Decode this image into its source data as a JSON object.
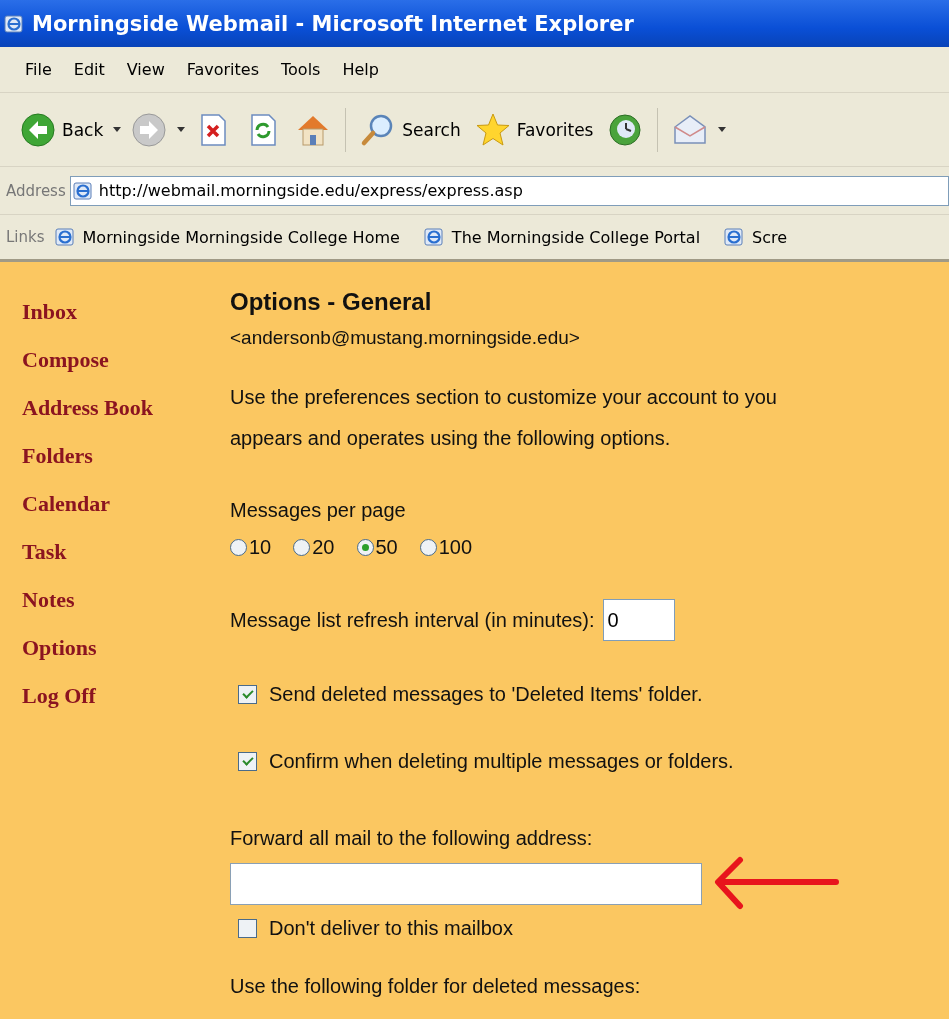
{
  "window": {
    "title": "Morningside Webmail - Microsoft Internet Explorer"
  },
  "menu": [
    "File",
    "Edit",
    "View",
    "Favorites",
    "Tools",
    "Help"
  ],
  "toolbar": [
    {
      "kind": "back",
      "label": "Back"
    },
    {
      "kind": "forward"
    },
    {
      "kind": "stop"
    },
    {
      "kind": "refresh"
    },
    {
      "kind": "home"
    },
    {
      "kind": "search",
      "label": "Search"
    },
    {
      "kind": "favorites",
      "label": "Favorites"
    },
    {
      "kind": "media"
    },
    {
      "kind": "mail"
    }
  ],
  "address": {
    "label": "Address",
    "url": "http://webmail.morningside.edu/express/express.asp"
  },
  "links": {
    "label": "Links",
    "items": [
      "Morningside Morningside College Home",
      "The Morningside College Portal",
      "Scre"
    ]
  },
  "sidebar": {
    "items": [
      "Inbox",
      "Compose",
      "Address Book",
      "Folders",
      "Calendar",
      "Task",
      "Notes",
      "Options",
      "Log Off"
    ]
  },
  "options": {
    "heading": "Options - General",
    "account": "<andersonb@mustang.morningside.edu>",
    "intro_lines": [
      "Use the preferences section to customize your account to you",
      "appears and operates using the following options."
    ],
    "messages_per_page": {
      "label": "Messages per page",
      "options": [
        {
          "label": "10",
          "selected": false
        },
        {
          "label": "20",
          "selected": false
        },
        {
          "label": "50",
          "selected": true
        },
        {
          "label": "100",
          "selected": false
        }
      ]
    },
    "refresh": {
      "label": "Message list refresh interval (in minutes):",
      "value": "0"
    },
    "checkboxes": [
      {
        "label": "Send deleted messages to 'Deleted Items' folder.",
        "checked": true
      },
      {
        "label": "Confirm when deleting multiple messages or folders.",
        "checked": true
      }
    ],
    "forward": {
      "label": "Forward all mail to the following address:"
    },
    "dont_deliver": {
      "label": "Don't deliver to this mailbox",
      "checked": false
    },
    "next_section": "Use the following folder for deleted messages:"
  }
}
